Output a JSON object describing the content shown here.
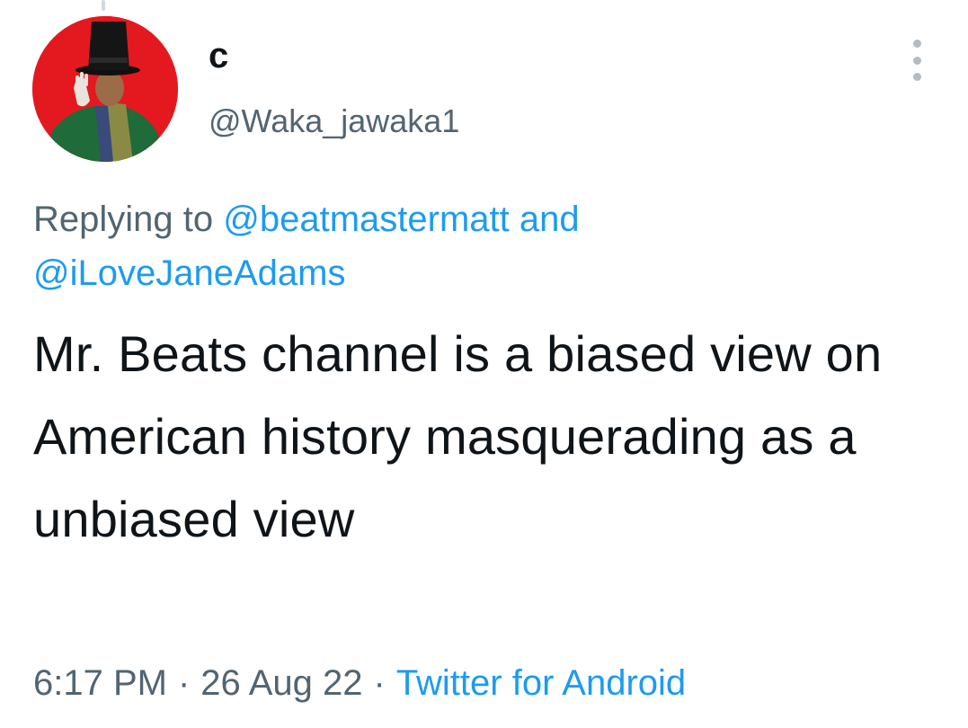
{
  "tweet": {
    "author": {
      "display_name": "c",
      "handle": "@Waka_jawaka1"
    },
    "reply_context": {
      "prefix": "Replying to",
      "mention_1": "@beatmastermatt",
      "conjunction": "and",
      "mention_2": "@iLoveJaneAdams"
    },
    "text": "Mr. Beats channel is a biased view on American history masquerading as a unbiased view",
    "meta": {
      "time": "6:17 PM",
      "separator": "·",
      "date": "26 Aug 22",
      "source": "Twitter for Android"
    }
  },
  "icons": {
    "more": "more-vertical-icon"
  },
  "colors": {
    "text_primary": "#0f1419",
    "text_secondary": "#536471",
    "accent": "#1d9bf0",
    "avatar_background": "#e3191f"
  }
}
